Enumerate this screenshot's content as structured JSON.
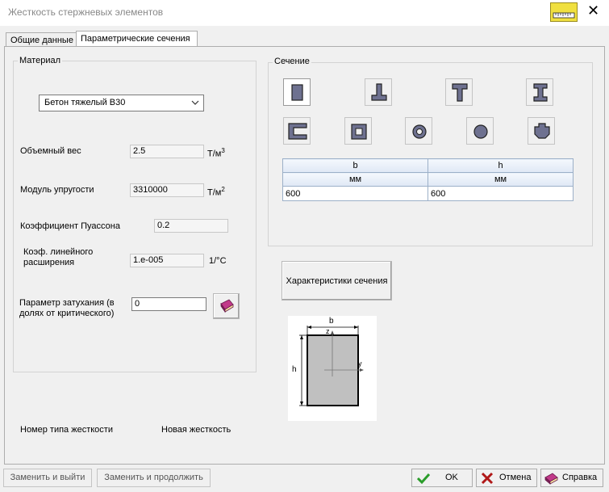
{
  "window": {
    "title": "Жесткость стержневых элементов"
  },
  "tabs": [
    {
      "label": "Общие данные"
    },
    {
      "label": "Параметрические сечения"
    }
  ],
  "material": {
    "group_label": "Материал",
    "selected": "Бетон тяжелый B30",
    "volume_weight": {
      "label": "Объемный вес",
      "value": "2.5",
      "unit": "Т/м",
      "unit_sup": "3"
    },
    "elastic_modulus": {
      "label": "Модуль упругости",
      "value": "3310000",
      "unit": "Т/м",
      "unit_sup": "2"
    },
    "poisson": {
      "label": "Коэффициент Пуассона",
      "value": "0.2"
    },
    "thermal": {
      "label_line1": "Коэф. линейного",
      "label_line2": "расширения",
      "value": "1.e-005",
      "unit": "1/°C"
    },
    "damping": {
      "label_line1": "Параметр затухания (в",
      "label_line2": "долях от критического)",
      "value": "0"
    }
  },
  "section": {
    "group_label": "Сечение",
    "shapes_row1": [
      "rectangle-section-icon",
      "t-inverted-section-icon",
      "t-section-icon",
      "i-beam-section-icon"
    ],
    "shapes_row2": [
      "channel-section-icon",
      "box-section-icon",
      "ring-section-icon",
      "circle-section-icon",
      "cross-section-icon"
    ],
    "table": {
      "headers": [
        "b",
        "h"
      ],
      "units": [
        "мм",
        "мм"
      ],
      "values": [
        "600",
        "600"
      ]
    },
    "characteristics_button": "Характеристики сечения",
    "diagram": {
      "b": "b",
      "h": "h",
      "z": "z",
      "y": "y"
    }
  },
  "stiffness": {
    "type_label": "Номер типа жесткости",
    "type_value": "Новая жесткость"
  },
  "buttons": {
    "replace_exit": "Заменить и выйти",
    "replace_continue": "Заменить и продолжить",
    "ok": "OK",
    "cancel": "Отмена",
    "help": "Справка"
  },
  "colors": {
    "accent_shape": "#6e7190",
    "ok_green": "#2a9d2a",
    "cancel_red": "#b01818"
  }
}
